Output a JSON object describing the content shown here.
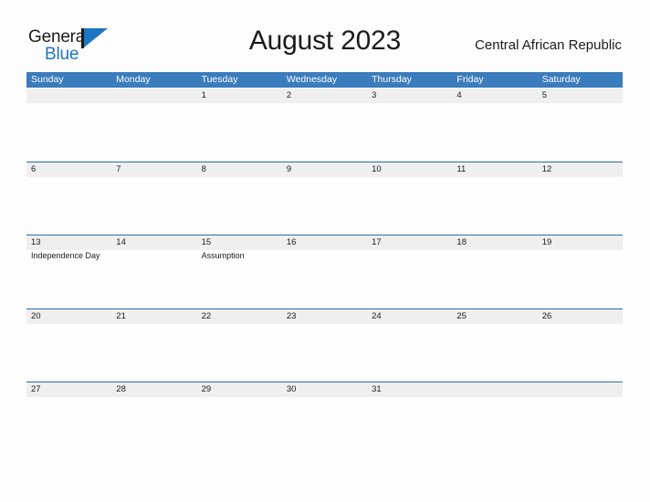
{
  "brand": {
    "word_one": "General",
    "word_two": "Blue",
    "flag_icon": "flag-icon",
    "accent_color": "#1d76c4"
  },
  "header": {
    "title": "August 2023",
    "country": "Central African Republic"
  },
  "theme": {
    "header_blue": "#3b7cbd",
    "rule_blue": "#2c6cab",
    "band_gray": "#efefef",
    "page_background": "#fdfdfd"
  },
  "calendar": {
    "weekdays": [
      "Sunday",
      "Monday",
      "Tuesday",
      "Wednesday",
      "Thursday",
      "Friday",
      "Saturday"
    ],
    "weeks": [
      [
        {
          "day": ""
        },
        {
          "day": ""
        },
        {
          "day": "1"
        },
        {
          "day": "2"
        },
        {
          "day": "3"
        },
        {
          "day": "4"
        },
        {
          "day": "5"
        }
      ],
      [
        {
          "day": "6"
        },
        {
          "day": "7"
        },
        {
          "day": "8"
        },
        {
          "day": "9"
        },
        {
          "day": "10"
        },
        {
          "day": "11"
        },
        {
          "day": "12"
        }
      ],
      [
        {
          "day": "13",
          "event": "Independence Day"
        },
        {
          "day": "14"
        },
        {
          "day": "15",
          "event": "Assumption"
        },
        {
          "day": "16"
        },
        {
          "day": "17"
        },
        {
          "day": "18"
        },
        {
          "day": "19"
        }
      ],
      [
        {
          "day": "20"
        },
        {
          "day": "21"
        },
        {
          "day": "22"
        },
        {
          "day": "23"
        },
        {
          "day": "24"
        },
        {
          "day": "25"
        },
        {
          "day": "26"
        }
      ],
      [
        {
          "day": "27"
        },
        {
          "day": "28"
        },
        {
          "day": "29"
        },
        {
          "day": "30"
        },
        {
          "day": "31"
        },
        {
          "day": ""
        },
        {
          "day": ""
        }
      ]
    ]
  }
}
